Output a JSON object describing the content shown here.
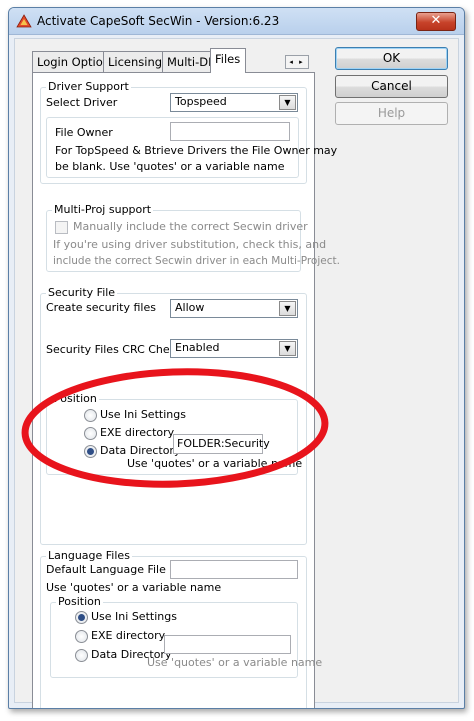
{
  "window": {
    "title": "Activate CapeSoft SecWin - Version:6.23",
    "close_label": "✕"
  },
  "tabs": [
    {
      "label": "Login Options"
    },
    {
      "label": "Licensing"
    },
    {
      "label": "Multi-DLL"
    },
    {
      "label": "Files",
      "active": true
    }
  ],
  "tab_scroll_label": "◂ ▸",
  "driver_support": {
    "group_label": "Driver Support",
    "select_driver_label": "Select Driver",
    "driver_value": "Topspeed",
    "file_owner_label": "File Owner",
    "file_owner_value": "",
    "file_owner_help_1": "For TopSpeed & Btrieve Drivers the File Owner may",
    "file_owner_help_2": "be blank. Use 'quotes' or a variable name"
  },
  "multi_proj": {
    "group_label": "Multi-Proj support",
    "checkbox_label": "Manually include the correct Secwin driver",
    "checked": false,
    "help_1": "If you're using driver substitution, check this, and",
    "help_2": "include the correct Secwin driver in each Multi-Project."
  },
  "security_file": {
    "group_label": "Security File",
    "create_label": "Create security files",
    "create_value": "Allow",
    "crc_label": "Security Files CRC Check",
    "crc_value": "Enabled",
    "position": {
      "group_label": "Position",
      "options": [
        "Use Ini Settings",
        "EXE directory",
        "Data Directory"
      ],
      "selected": 2,
      "path_value": "FOLDER:Security",
      "help": "Use 'quotes' or a variable name"
    }
  },
  "language_files": {
    "group_label": "Language Files",
    "default_label": "Default Language File",
    "default_value": "",
    "help": "Use 'quotes' or a variable name",
    "position": {
      "group_label": "Position",
      "options": [
        "Use Ini Settings",
        "EXE directory",
        "Data Directory"
      ],
      "selected": 0,
      "path_value": "",
      "help": "Use 'quotes' or a variable name"
    }
  },
  "buttons": {
    "ok": "OK",
    "cancel": "Cancel",
    "help": "Help"
  },
  "annotation_color": "#e8141c",
  "icons": {
    "app": "capesoft-triangle-icon",
    "dropdown": "chevron-down-icon"
  }
}
